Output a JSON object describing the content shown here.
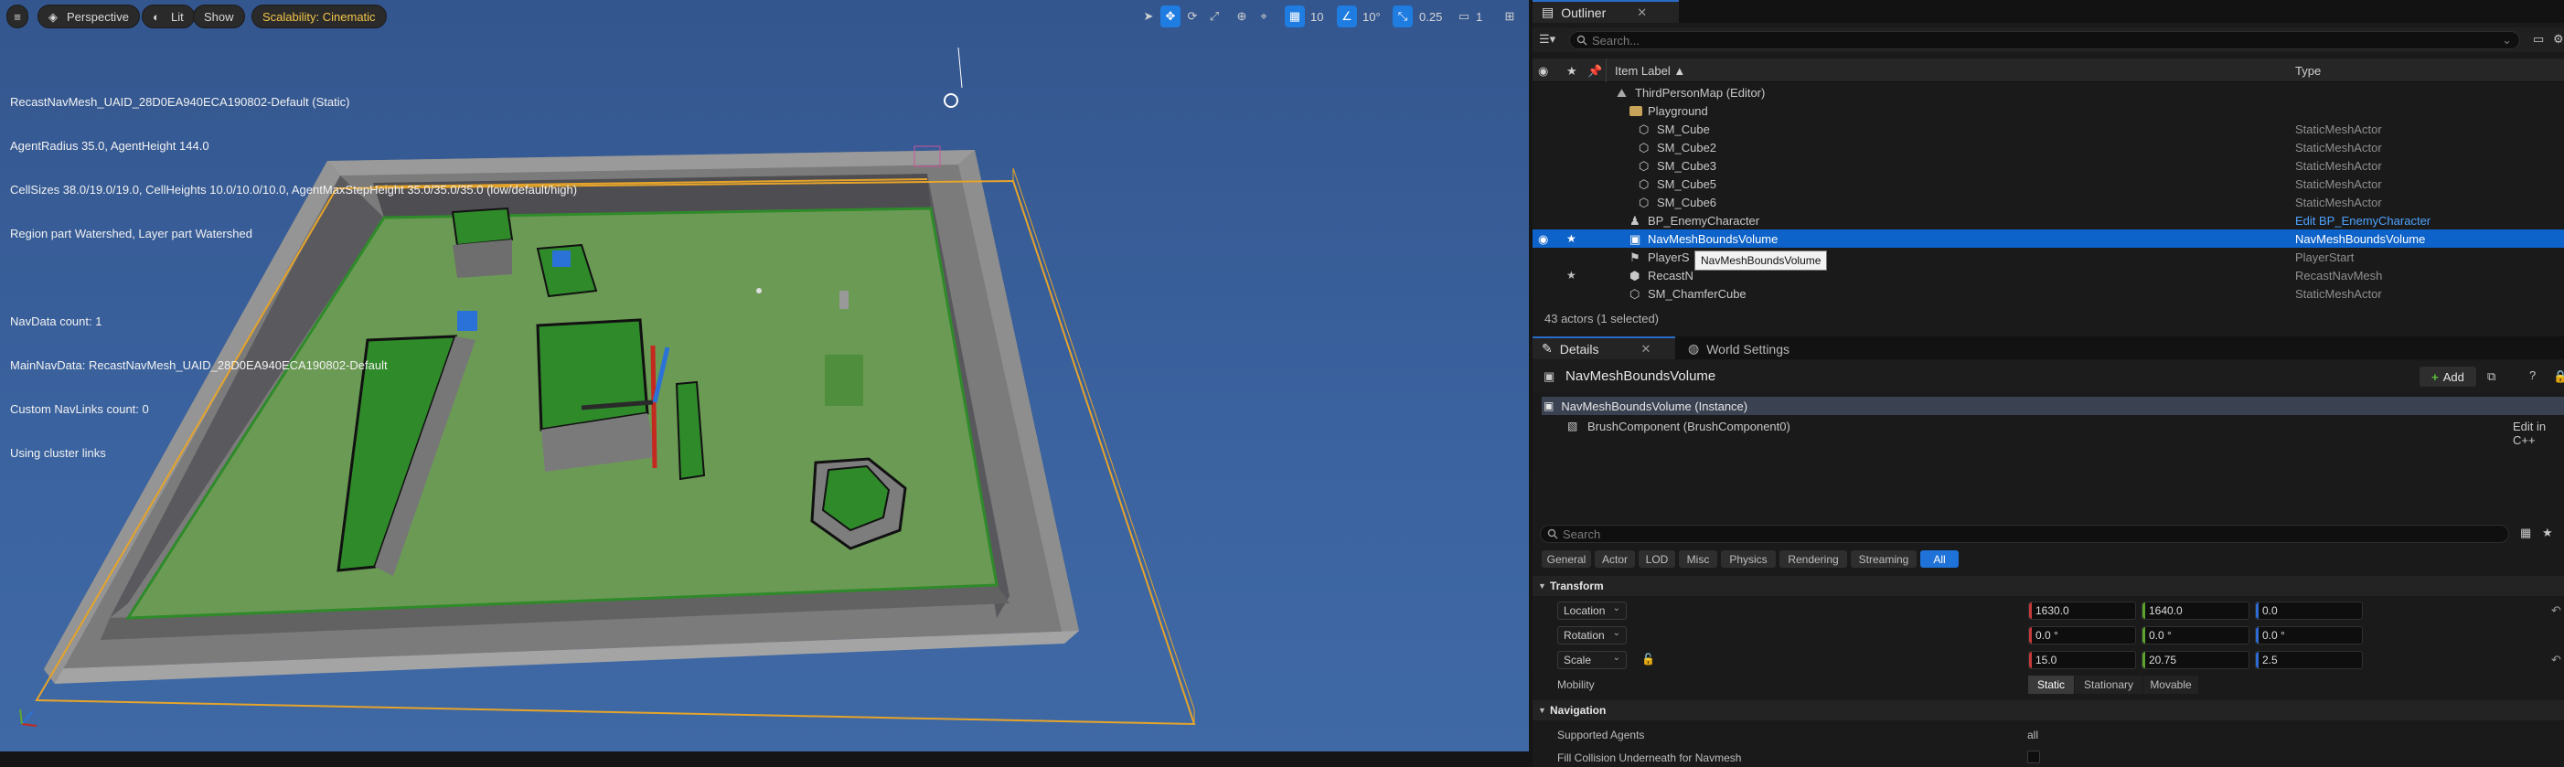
{
  "viewport": {
    "toolbar": {
      "perspective": "Perspective",
      "lit": "Lit",
      "show": "Show",
      "scalability": "Scalability: Cinematic",
      "grid_snap": "10",
      "rotation_snap": "10°",
      "scale_snap": "0.25",
      "camera_speed": "1"
    },
    "stats": [
      "RecastNavMesh_UAID_28D0EA940ECA190802-Default (Static)",
      "AgentRadius 35.0, AgentHeight 144.0",
      "CellSizes 38.0/19.0/19.0, CellHeights 10.0/10.0/10.0, AgentMaxStepHeight 35.0/35.0/35.0 (low/default/high)",
      "Region part Watershed, Layer part Watershed",
      "",
      "NavData count: 1",
      "MainNavData: RecastNavMesh_UAID_28D0EA940ECA190802-Default",
      "Custom NavLinks count: 0",
      "Using cluster links"
    ],
    "colors": {
      "sky": "#3a629e",
      "floor": "#6b9a55",
      "navmesh": "#2f8a2a",
      "bounds": "#e6a42a"
    }
  },
  "outliner": {
    "tab_label": "Outliner",
    "search_placeholder": "Search...",
    "column_label": "Item Label ▲",
    "column_type": "Type",
    "rows": [
      {
        "label": "ThirdPersonMap (Editor)",
        "type": ""
      },
      {
        "label": "Playground",
        "type": ""
      },
      {
        "label": "SM_Cube",
        "type": "StaticMeshActor"
      },
      {
        "label": "SM_Cube2",
        "type": "StaticMeshActor"
      },
      {
        "label": "SM_Cube3",
        "type": "StaticMeshActor"
      },
      {
        "label": "SM_Cube5",
        "type": "StaticMeshActor"
      },
      {
        "label": "SM_Cube6",
        "type": "StaticMeshActor"
      },
      {
        "label": "BP_EnemyCharacter",
        "type": "Edit BP_EnemyCharacter"
      },
      {
        "label": "NavMeshBoundsVolume",
        "type": "NavMeshBoundsVolume"
      },
      {
        "label": "PlayerS",
        "type": "PlayerStart"
      },
      {
        "label": "RecastN",
        "type": "RecastNavMesh"
      },
      {
        "label": "SM_ChamferCube",
        "type": "StaticMeshActor"
      }
    ],
    "tooltip": "NavMeshBoundsVolume",
    "status": "43 actors (1 selected)",
    "colors": {
      "selected": "#0d63c9",
      "link": "#4ea3ff"
    }
  },
  "details": {
    "tab_label": "Details",
    "world_settings_label": "World Settings",
    "actor_name": "NavMeshBoundsVolume",
    "add_label": "Add",
    "instance_label": "NavMeshBoundsVolume (Instance)",
    "component_label": "BrushComponent (BrushComponent0)",
    "edit_cpp": "Edit in C++",
    "search_placeholder": "Search",
    "filters": [
      "General",
      "Actor",
      "LOD",
      "Misc",
      "Physics",
      "Rendering",
      "Streaming",
      "All"
    ],
    "transform": {
      "header": "Transform",
      "location_label": "Location",
      "location": [
        "1630.0",
        "1640.0",
        "0.0"
      ],
      "rotation_label": "Rotation",
      "rotation": [
        "0.0 °",
        "0.0 °",
        "0.0 °"
      ],
      "scale_label": "Scale",
      "scale": [
        "15.0",
        "20.75",
        "2.5"
      ],
      "mobility_label": "Mobility",
      "mobility_options": [
        "Static",
        "Stationary",
        "Movable"
      ]
    },
    "navigation": {
      "header": "Navigation",
      "supported_agents_label": "Supported Agents",
      "supported_agents_value": "all",
      "fill_collision_label": "Fill Collision Underneath for Navmesh"
    }
  }
}
